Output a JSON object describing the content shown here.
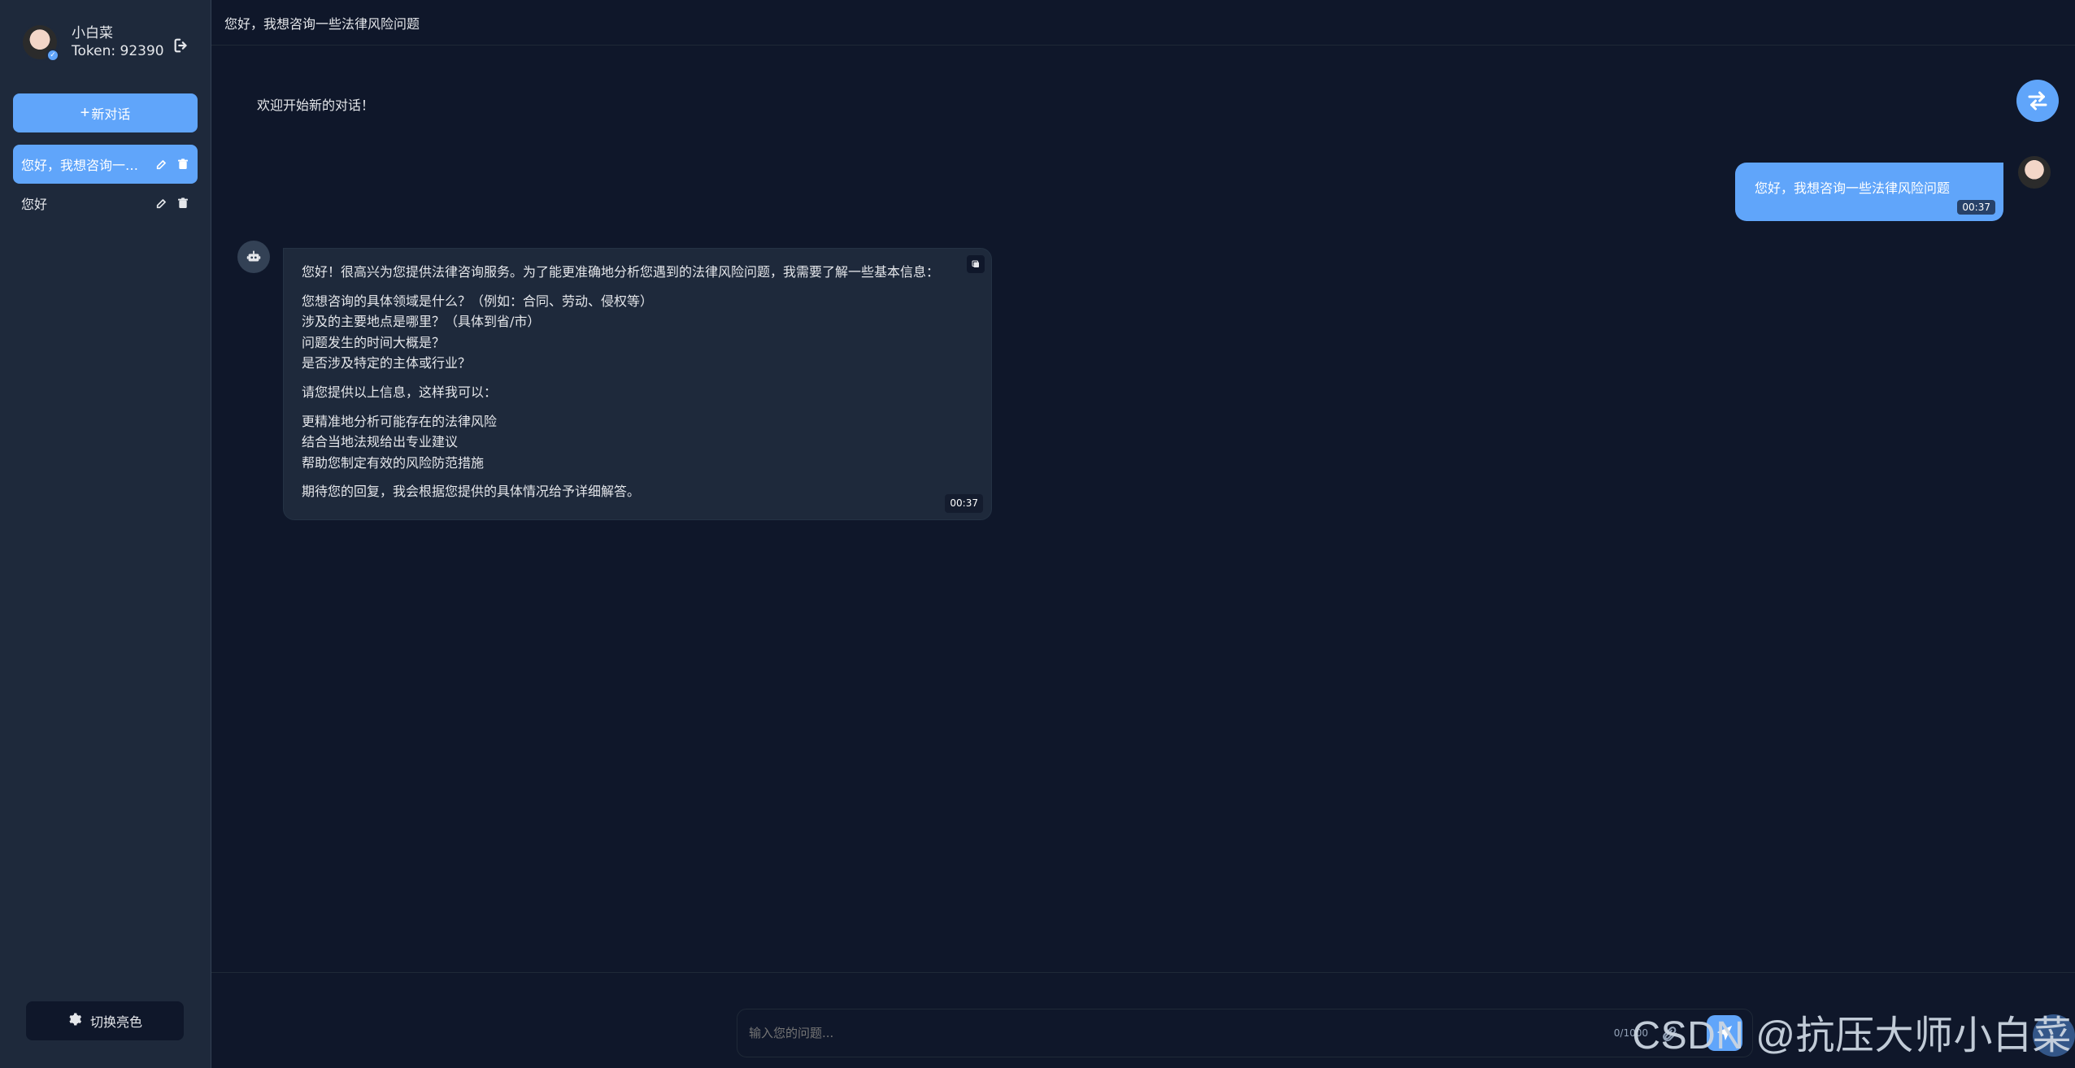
{
  "sidebar": {
    "user": {
      "name": "小白菜",
      "token_label": "Token: 92390"
    },
    "new_chat_label": "新对话",
    "conversations": [
      {
        "title": "您好，我想咨询一些..."
      },
      {
        "title": "您好"
      }
    ],
    "theme_toggle_label": "切换亮色"
  },
  "header": {
    "title": "您好，我想咨询一些法律风险问题"
  },
  "chat": {
    "welcome": "欢迎开始新的对话！",
    "user_message": {
      "text": "您好，我想咨询一些法律风险问题",
      "time": "00:37"
    },
    "bot_message": {
      "intro": "您好！很高兴为您提供法律咨询服务。为了能更准确地分析您遇到的法律风险问题，我需要了解一些基本信息：",
      "questions": [
        "您想咨询的具体领域是什么？（例如：合同、劳动、侵权等）",
        "涉及的主要地点是哪里？（具体到省/市）",
        "问题发生的时间大概是？",
        "是否涉及特定的主体或行业？"
      ],
      "mid": "请您提供以上信息，这样我可以：",
      "benefits": [
        "更精准地分析可能存在的法律风险",
        "结合当地法规给出专业建议",
        "帮助您制定有效的风险防范措施"
      ],
      "outro": "期待您的回复，我会根据您提供的具体情况给予详细解答。",
      "time": "00:37"
    }
  },
  "input": {
    "placeholder": "输入您的问题...",
    "count": "0/1000"
  },
  "watermark": "CSDN @抗压大师小白菜",
  "colors": {
    "bg": "#0f172a",
    "sidebar": "#1e293b",
    "accent": "#60a5fa"
  },
  "icons": {
    "logout": "logout-icon",
    "edit": "edit-icon",
    "trash": "trash-icon",
    "gear": "gear-icon",
    "swap": "swap-icon",
    "bot": "bot-icon",
    "copy": "copy-icon",
    "clip": "paperclip-icon",
    "send": "send-icon"
  }
}
